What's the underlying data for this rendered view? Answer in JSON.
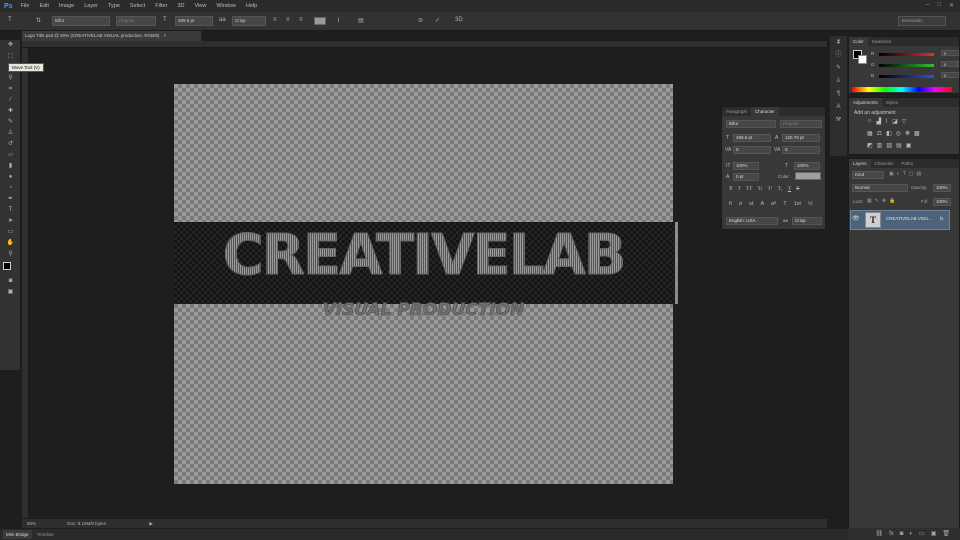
{
  "app": {
    "logo": "Ps"
  },
  "menu": [
    "File",
    "Edit",
    "Image",
    "Layer",
    "Type",
    "Select",
    "Filter",
    "3D",
    "View",
    "Window",
    "Help"
  ],
  "window_controls": [
    "–",
    "□",
    "✕"
  ],
  "options_bar": {
    "font_family": "Bifur",
    "font_style": "Regular",
    "font_size": "289.6 pt",
    "aa_label": "aa",
    "antialias": "Crisp",
    "workspace": "Essentials"
  },
  "document": {
    "tab_title": "Logo Title.psd @ 50% (CREATIVELAB VISUAL production, RGB/8)",
    "close": "×"
  },
  "canvas": {
    "main_text": "CREATIVELAB",
    "sub_text": "VISUAL PRODUCTION"
  },
  "tooltip": "Move Tool (V)",
  "status": {
    "zoom": "50%",
    "doc_info": "Doc: 9.16M/0 bytes"
  },
  "bottom_tabs": [
    "Mini Bridge",
    "Timeline"
  ],
  "color_panel": {
    "tabs": [
      "Color",
      "Swatches"
    ],
    "rows": [
      {
        "label": "R",
        "value": "0",
        "color": "#e03030"
      },
      {
        "label": "G",
        "value": "0",
        "color": "#30c030"
      },
      {
        "label": "B",
        "value": "0",
        "color": "#3050e0"
      }
    ]
  },
  "adjustments_panel": {
    "tabs": [
      "Adjustments",
      "Styles"
    ],
    "title": "Add an adjustment"
  },
  "layers_panel": {
    "tabs": [
      "Layers",
      "Channels",
      "Paths"
    ],
    "kind_filter": "Kind",
    "blend_mode": "Normal",
    "opacity_label": "Opacity:",
    "opacity_value": "100%",
    "lock_label": "Lock:",
    "fill_label": "Fill:",
    "fill_value": "100%",
    "layer": {
      "thumb": "T",
      "name": "CREATIVELAB VISU...",
      "fx": "fx"
    }
  },
  "character_panel": {
    "tabs": [
      "Paragraph",
      "Character"
    ],
    "font_family": "Bifur",
    "font_style": "Regular",
    "font_size": "289.6 pt",
    "leading": "120.79 pt",
    "kerning": "0",
    "tracking": "0",
    "vertical_scale": "100%",
    "horizontal_scale": "100%",
    "baseline_shift": "0 pt",
    "color_label": "Color:",
    "language": "English: USA",
    "aa_label": "aa",
    "antialias": "Crisp",
    "style_buttons": [
      "T",
      "T",
      "TT",
      "Tr",
      "T¹",
      "T₁",
      "T",
      "T"
    ]
  }
}
